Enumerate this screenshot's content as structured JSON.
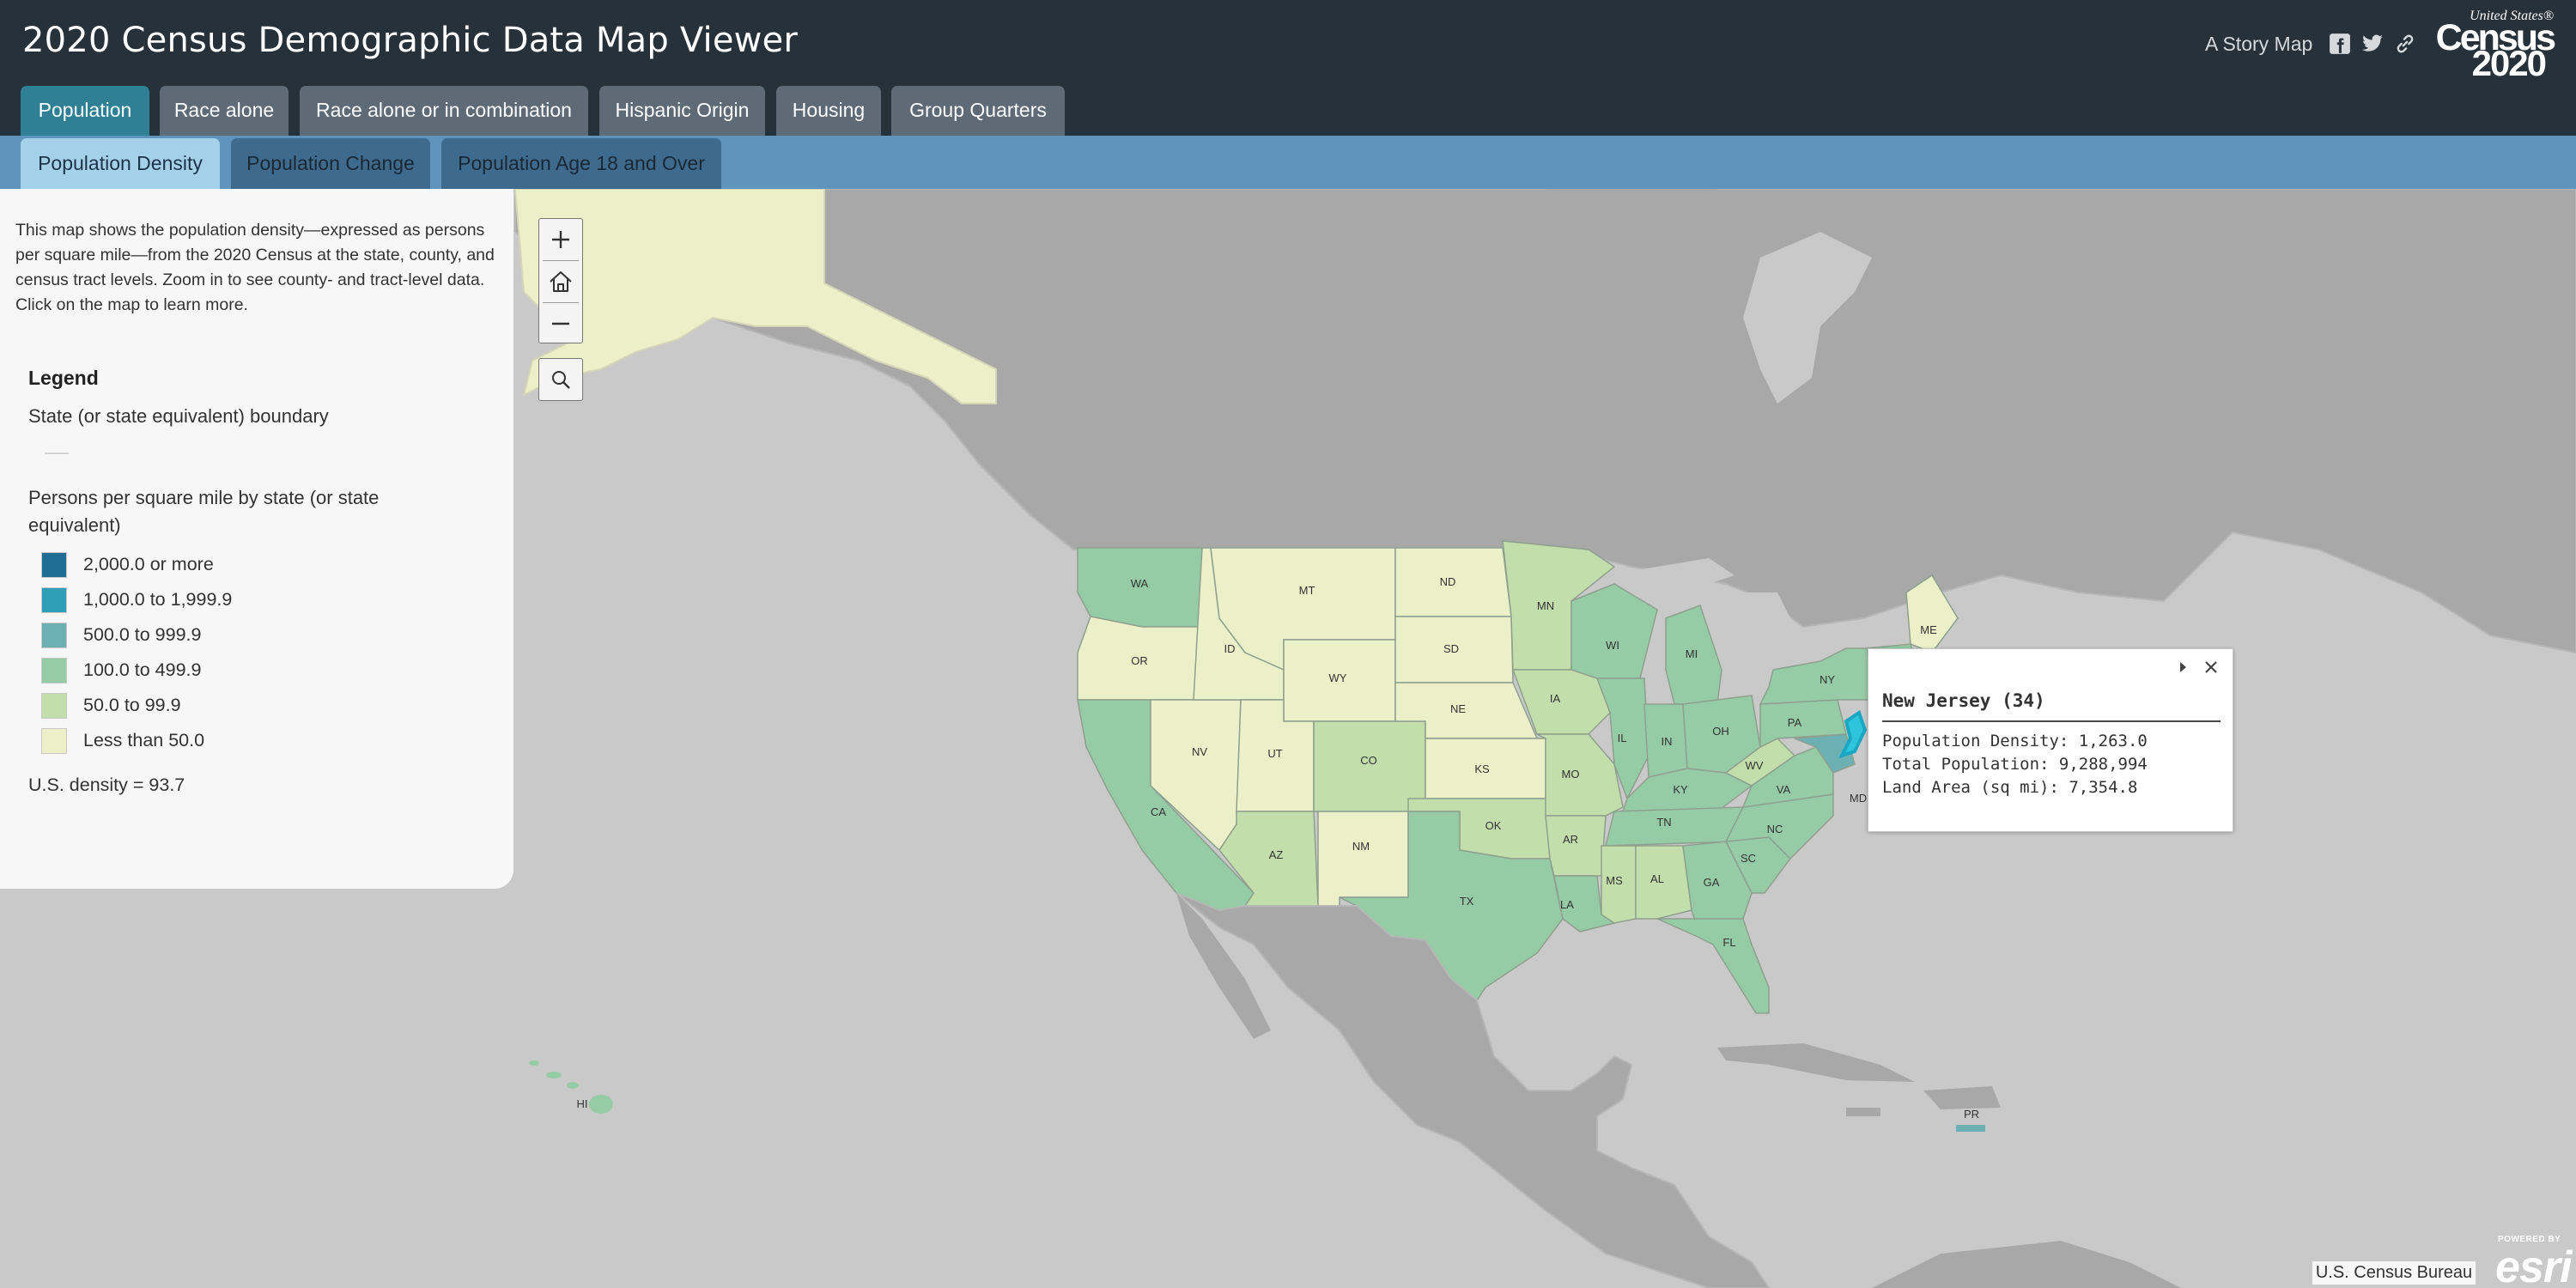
{
  "header": {
    "title": "2020 Census Demographic Data Map Viewer",
    "story_map": "A Story Map",
    "icons": [
      "facebook-icon",
      "twitter-icon",
      "link-icon"
    ],
    "logo": {
      "line1": "United States®",
      "line2": "Census",
      "line3": "2020"
    }
  },
  "tabs": [
    {
      "label": "Population",
      "active": true
    },
    {
      "label": "Race alone",
      "active": false
    },
    {
      "label": "Race alone or in combination",
      "active": false
    },
    {
      "label": "Hispanic Origin",
      "active": false
    },
    {
      "label": "Housing",
      "active": false
    },
    {
      "label": "Group Quarters",
      "active": false
    }
  ],
  "subtabs": [
    {
      "label": "Population Density",
      "active": true
    },
    {
      "label": "Population Change",
      "active": false
    },
    {
      "label": "Population Age 18 and Over",
      "active": false
    }
  ],
  "panel": {
    "description": "This map shows the population density—expressed as persons per square mile—from the 2020 Census at the state, county, and census tract levels. Zoom in to see county- and tract-level data. Click on the map to learn more.",
    "legend_title": "Legend",
    "boundary_label": "State (or state equivalent) boundary",
    "density_label": "Persons per square mile by state (or state equivalent)",
    "classes": [
      {
        "label": "2,000.0 or more",
        "color": "#1f6d94"
      },
      {
        "label": "1,000.0 to 1,999.9",
        "color": "#2f9fb8"
      },
      {
        "label": "500.0 to 999.9",
        "color": "#6cb0b3"
      },
      {
        "label": "100.0 to 499.9",
        "color": "#95cba5"
      },
      {
        "label": "50.0 to 99.9",
        "color": "#c2deab"
      },
      {
        "label": "Less than 50.0",
        "color": "#ebf0c8"
      }
    ],
    "us_density": "U.S. density = 93.7"
  },
  "map": {
    "controls": [
      "zoom-in",
      "home",
      "zoom-out",
      "search"
    ],
    "selected_state": "New Jersey",
    "state_labels": [
      "WA",
      "OR",
      "CA",
      "NV",
      "ID",
      "MT",
      "WY",
      "UT",
      "AZ",
      "NM",
      "CO",
      "ND",
      "SD",
      "NE",
      "KS",
      "OK",
      "TX",
      "MN",
      "IA",
      "MO",
      "AR",
      "LA",
      "WI",
      "IL",
      "MI",
      "IN",
      "OH",
      "KY",
      "TN",
      "MS",
      "AL",
      "GA",
      "FL",
      "SC",
      "NC",
      "VA",
      "WV",
      "PA",
      "NY",
      "MD",
      "ME",
      "HI",
      "PR"
    ],
    "state_classes": {
      "WA": "100.0 to 499.9",
      "OR": "Less than 50.0",
      "CA": "100.0 to 499.9",
      "NV": "Less than 50.0",
      "ID": "Less than 50.0",
      "MT": "Less than 50.0",
      "WY": "Less than 50.0",
      "UT": "Less than 50.0",
      "AZ": "50.0 to 99.9",
      "NM": "Less than 50.0",
      "CO": "50.0 to 99.9",
      "ND": "Less than 50.0",
      "SD": "Less than 50.0",
      "NE": "Less than 50.0",
      "KS": "Less than 50.0",
      "OK": "50.0 to 99.9",
      "TX": "100.0 to 499.9",
      "MN": "50.0 to 99.9",
      "IA": "50.0 to 99.9",
      "MO": "50.0 to 99.9",
      "AR": "50.0 to 99.9",
      "LA": "100.0 to 499.9",
      "WI": "100.0 to 499.9",
      "IL": "100.0 to 499.9",
      "MI": "100.0 to 499.9",
      "IN": "100.0 to 499.9",
      "OH": "100.0 to 499.9",
      "KY": "100.0 to 499.9",
      "TN": "100.0 to 499.9",
      "MS": "50.0 to 99.9",
      "AL": "50.0 to 99.9",
      "GA": "100.0 to 499.9",
      "FL": "100.0 to 499.9",
      "SC": "100.0 to 499.9",
      "NC": "100.0 to 499.9",
      "VA": "100.0 to 499.9",
      "WV": "50.0 to 99.9",
      "PA": "100.0 to 499.9",
      "NY": "100.0 to 499.9",
      "MD": "500.0 to 999.9",
      "ME": "Less than 50.0",
      "HI": "100.0 to 499.9",
      "PR": "500.0 to 999.9",
      "NJ": "1,000.0 to 1,999.9"
    }
  },
  "popup": {
    "title": "New Jersey (34)",
    "lines": [
      "Population Density: 1,263.0",
      "Total Population: 9,288,994",
      "Land Area (sq mi): 7,354.8"
    ]
  },
  "attribution": "U.S. Census Bureau",
  "esri": {
    "powered_by": "POWERED BY",
    "name": "esri"
  }
}
